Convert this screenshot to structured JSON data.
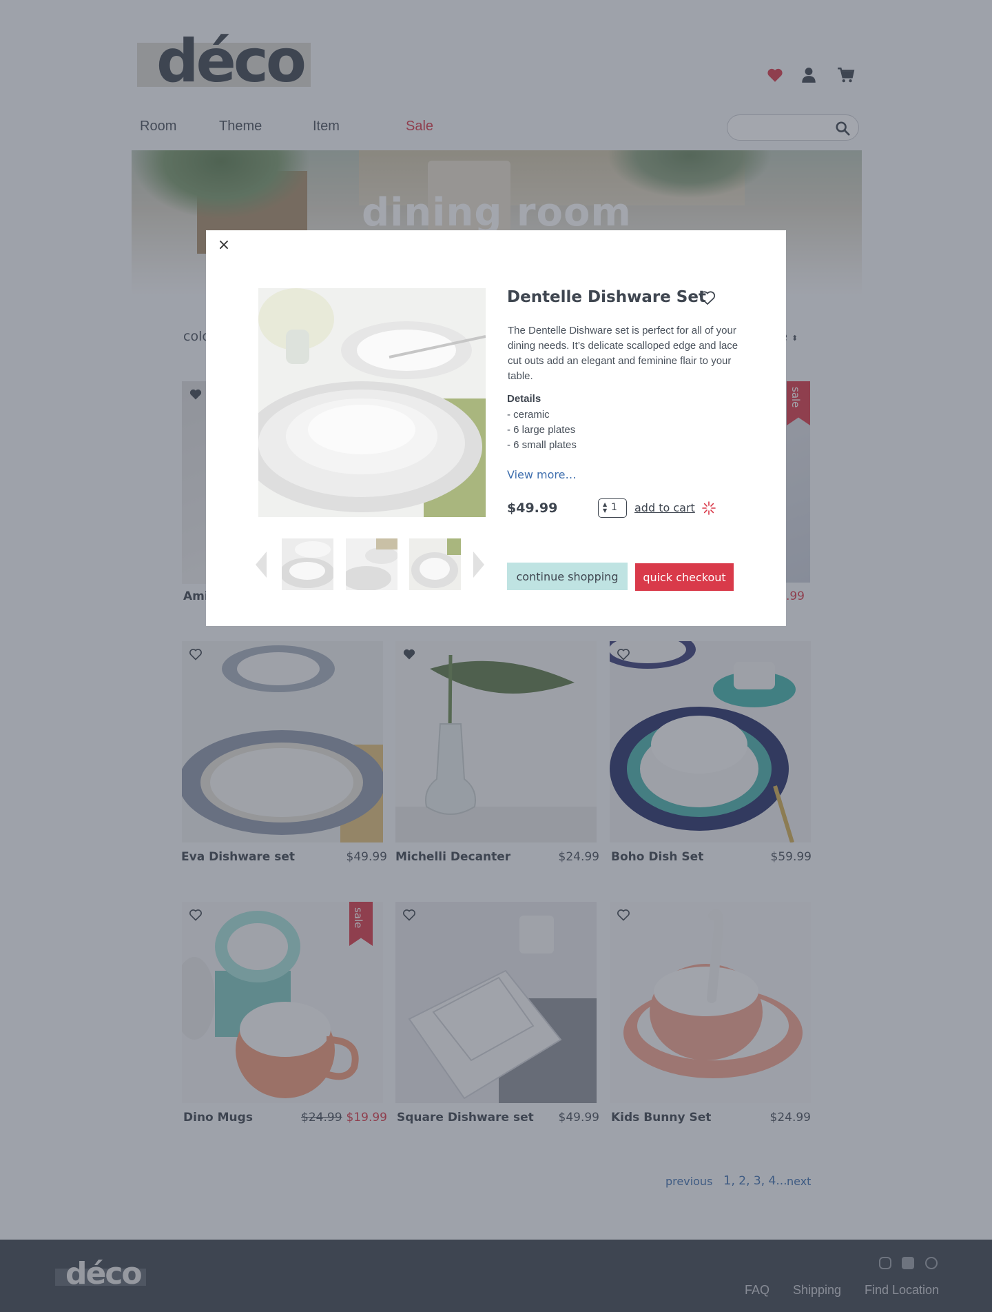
{
  "header": {
    "logo": "déco",
    "icons": [
      "heart-icon",
      "user-icon",
      "cart-icon"
    ],
    "nav": [
      "Room",
      "Theme",
      "Item",
      "Sale"
    ],
    "search_placeholder": ""
  },
  "hero": {
    "title": "dining room"
  },
  "filters": {
    "left": "colo",
    "right": "le"
  },
  "products": [
    {
      "name": "Eva Dishware set",
      "price": "$49.99",
      "favorited": false,
      "sale": false
    },
    {
      "name": "Michelli Decanter",
      "price": "$24.99",
      "favorited": true,
      "sale": false
    },
    {
      "name": "Boho Dish Set",
      "price": "$59.99",
      "favorited": false,
      "sale": false
    },
    {
      "name": "Dino Mugs",
      "old_price": "$24.99",
      "price": "$19.99",
      "favorited": false,
      "sale": true,
      "sale_label": "sale"
    },
    {
      "name": "Square Dishware set",
      "price": "$49.99",
      "favorited": false,
      "sale": false
    },
    {
      "name": "Kids Bunny Set",
      "price": "$24.99",
      "favorited": false,
      "sale": false
    }
  ],
  "partial_row": {
    "left_name": "Ami",
    "right_price": ".99",
    "right_sale_label": "sale"
  },
  "pagination": {
    "previous": "previous",
    "current": "1",
    "pages": ", 2, 3, 4...",
    "next": "next"
  },
  "footer": {
    "logo": "déco",
    "social": [
      "instagram-icon",
      "facebook-icon",
      "pinterest-icon"
    ],
    "links": [
      "FAQ",
      "Shipping",
      "Find Location"
    ]
  },
  "modal": {
    "close": "×",
    "title": "Dentelle Dishware Set",
    "description": "The Dentelle Dishware set is perfect for all of your dining needs. It’s delicate scalloped edge and lace cut outs add an elegant and feminine flair to your table.",
    "details_heading": "Details",
    "details": [
      "- ceramic",
      "- 6 large plates",
      "- 6 small plates"
    ],
    "view_more": "View more…",
    "price": "$49.99",
    "quantity": "1",
    "add_to_cart": "add to cart",
    "continue_shopping": "continue shopping",
    "quick_checkout": "quick checkout"
  },
  "colors": {
    "accent_red": "#d93a4a",
    "text_dark": "#3f4650",
    "link_blue": "#3f6fae",
    "mint": "#bfe3e2"
  }
}
